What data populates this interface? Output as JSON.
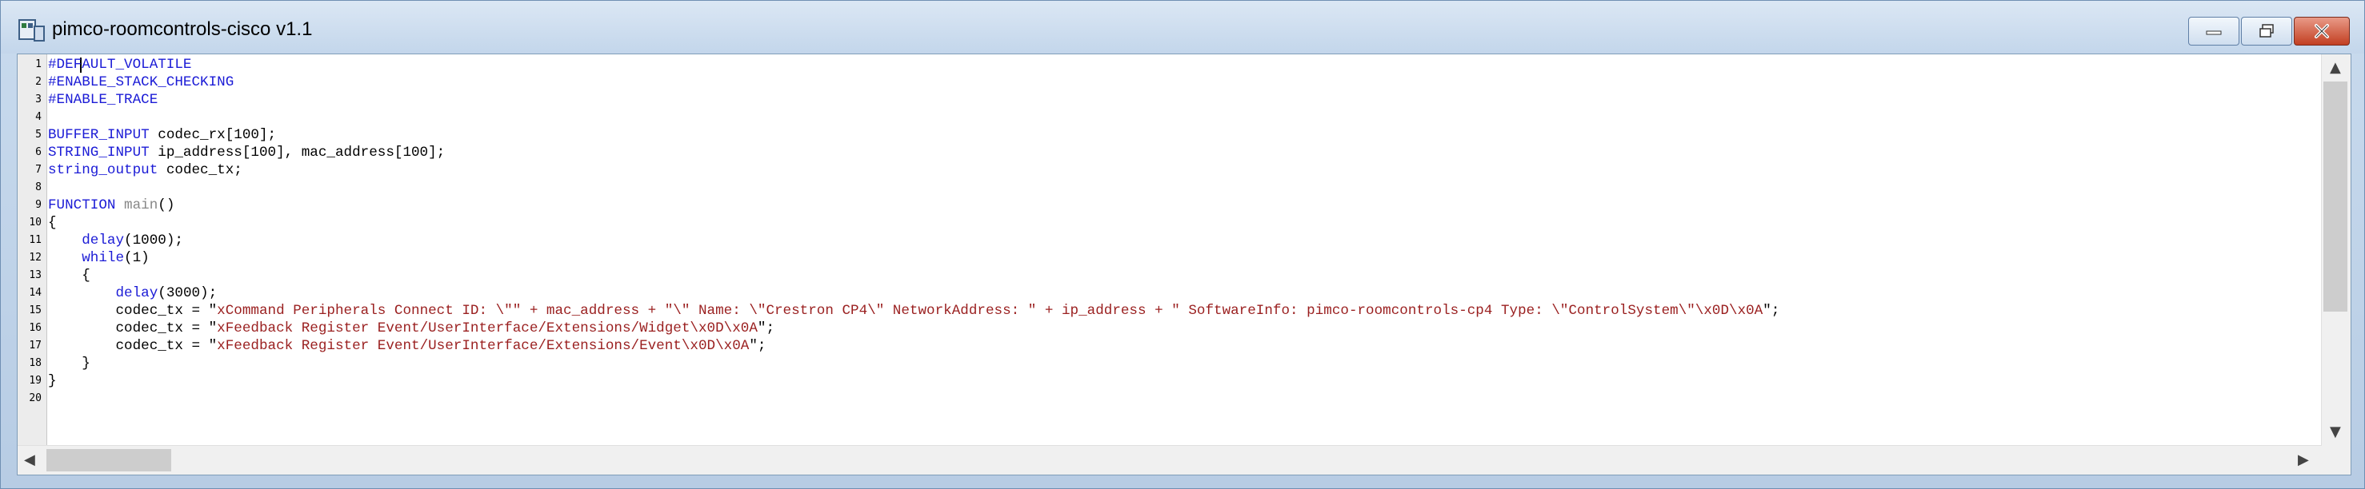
{
  "window": {
    "title": "pimco-roomcontrols-cisco v1.1",
    "buttons": [
      "minimize-icon",
      "maximize-icon",
      "close-icon"
    ]
  },
  "editor": {
    "line_numbers": [
      "1",
      "2",
      "3",
      "4",
      "5",
      "6",
      "7",
      "8",
      "9",
      "10",
      "11",
      "12",
      "13",
      "14",
      "15",
      "16",
      "17",
      "18",
      "19",
      "20"
    ],
    "lines": [
      [
        [
          "kw",
          "#DEFAULT_VOLATILE"
        ]
      ],
      [
        [
          "kw",
          "#ENABLE_STACK_CHECKING"
        ]
      ],
      [
        [
          "kw",
          "#ENABLE_TRACE"
        ]
      ],
      [],
      [
        [
          "kw",
          "BUFFER_INPUT"
        ],
        [
          "t",
          " codec_rx[100];"
        ]
      ],
      [
        [
          "kw",
          "STRING_INPUT"
        ],
        [
          "t",
          " ip_address[100], mac_address[100];"
        ]
      ],
      [
        [
          "kw",
          "string_output"
        ],
        [
          "t",
          " codec_tx;"
        ]
      ],
      [],
      [
        [
          "kw",
          "FUNCTION"
        ],
        [
          "t",
          " "
        ],
        [
          "fn",
          "main"
        ],
        [
          "t",
          "()"
        ]
      ],
      [
        [
          "t",
          "{"
        ]
      ],
      [
        [
          "t",
          "    "
        ],
        [
          "kw",
          "delay"
        ],
        [
          "t",
          "(1000);"
        ]
      ],
      [
        [
          "t",
          "    "
        ],
        [
          "kw",
          "while"
        ],
        [
          "t",
          "(1)"
        ]
      ],
      [
        [
          "t",
          "    {"
        ]
      ],
      [
        [
          "t",
          "        "
        ],
        [
          "kw",
          "delay"
        ],
        [
          "t",
          "(3000);"
        ]
      ],
      [
        [
          "t",
          "        codec_tx = \""
        ],
        [
          "str",
          "xCommand Peripherals Connect ID: \\\"\" + mac_address + \"\\\" Name: \\\"Crestron CP4\\\" NetworkAddress: \" + ip_address + \" SoftwareInfo: pimco-roomcontrols-cp4 Type: \\\"ControlSystem\\\"\\x0D\\x0A"
        ],
        [
          "t",
          "\";"
        ]
      ],
      [
        [
          "t",
          "        codec_tx = \""
        ],
        [
          "str",
          "xFeedback Register Event/UserInterface/Extensions/Widget\\x0D\\x0A"
        ],
        [
          "t",
          "\";"
        ]
      ],
      [
        [
          "t",
          "        codec_tx = \""
        ],
        [
          "str",
          "xFeedback Register Event/UserInterface/Extensions/Event\\x0D\\x0A"
        ],
        [
          "t",
          "\";"
        ]
      ],
      [
        [
          "t",
          "    }"
        ]
      ],
      [
        [
          "t",
          "}"
        ]
      ],
      []
    ]
  },
  "scroll": {
    "up_arrow": "▲",
    "down_arrow": "▼",
    "left_arrow": "◀",
    "right_arrow": "▶"
  },
  "colors": {
    "keyword": "#1b1bd6",
    "string": "#9a1f1f",
    "function": "#888888"
  }
}
